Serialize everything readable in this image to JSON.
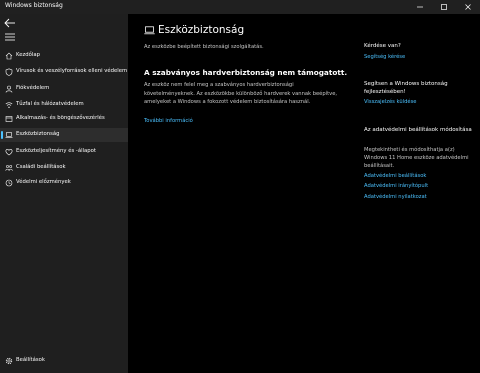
{
  "window": {
    "title": "Windows biztonság"
  },
  "sidebar": {
    "items": [
      {
        "label": "Kezdőlap",
        "icon": "home-icon"
      },
      {
        "label": "Vírusok és veszélyforrások elleni védelem",
        "icon": "shield-icon"
      },
      {
        "label": "Fiókvédelem",
        "icon": "person-icon"
      },
      {
        "label": "Tűzfal és hálózatvédelem",
        "icon": "wifi-icon"
      },
      {
        "label": "Alkalmazás- és böngészővezérlés",
        "icon": "app-window-icon"
      },
      {
        "label": "Eszközbiztonság",
        "icon": "laptop-icon",
        "active": true
      },
      {
        "label": "Eszközteljesítmény és -állapot",
        "icon": "heart-icon"
      },
      {
        "label": "Családi beállítások",
        "icon": "family-icon"
      },
      {
        "label": "Védelmi előzmények",
        "icon": "history-icon"
      }
    ],
    "settings_label": "Beállítások"
  },
  "main": {
    "title": "Eszközbiztonság",
    "subtitle": "Az eszközbe beépített biztonsági szolgáltatás.",
    "section_heading": "A szabványos hardverbiztonság nem támogatott.",
    "section_body": "Az eszköz nem felel meg a szabványos hardverbiztonsági követelményeknek. Az eszközökbe különböző hardverek vannak beépítve, amelyeket a Windows a fokozott védelem biztosítására használ.",
    "more_info_link": "További információ"
  },
  "right": {
    "question_heading": "Kérdése van?",
    "help_link": "Segítség kérése",
    "improve_heading": "Segítsen a Windows biztonság fejlesztésében!",
    "feedback_link": "Visszajelzés küldése",
    "privacy_heading": "Az adatvédelmi beállítások módosítása",
    "privacy_body": "Megtekintheti és módosíthatja a(z) Windows 11 Home eszköze adatvédelmi beállításait.",
    "privacy_links": [
      "Adatvédelmi beállítások",
      "Adatvédelmi irányítópult",
      "Adatvédelmi nyilatkozat"
    ]
  },
  "colors": {
    "accent": "#4cc2ff",
    "sidebar_bg": "#1f1f1f",
    "main_bg": "#000000"
  }
}
